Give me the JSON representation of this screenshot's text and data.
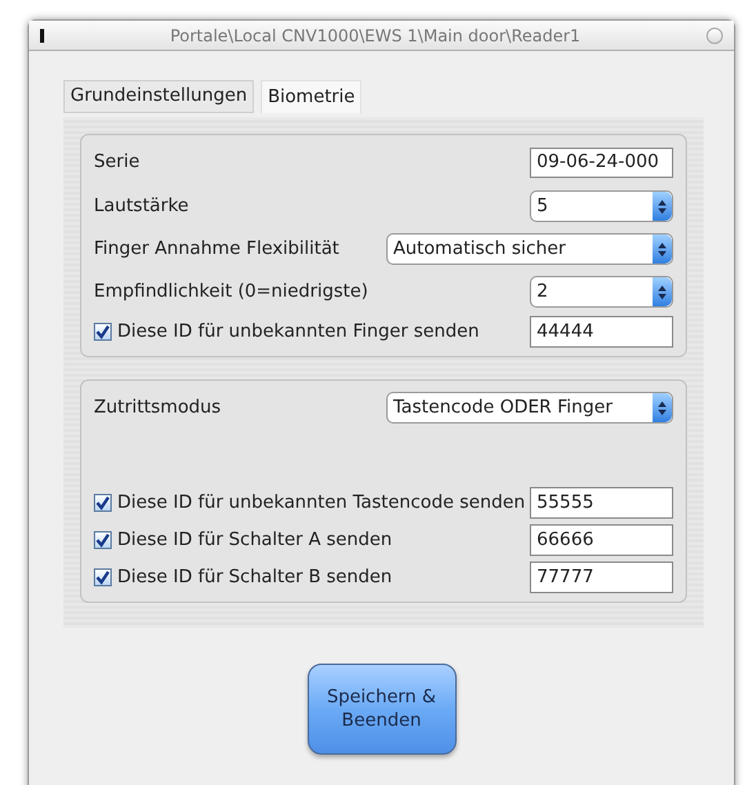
{
  "window": {
    "title": "Portale\\Local CNV1000\\EWS 1\\Main door\\Reader1"
  },
  "tabs": [
    {
      "label": "Grundeinstellungen",
      "selected": false
    },
    {
      "label": "Biometrie",
      "selected": true
    }
  ],
  "groups": [
    {
      "rows": [
        {
          "kind": "field",
          "label": "Serie",
          "value": "09-06-24-000"
        },
        {
          "kind": "select",
          "label": "Lautstärke",
          "value": "5"
        },
        {
          "kind": "wide_select",
          "label": "Finger Annahme Flexibilität",
          "value": "Automatisch sicher"
        },
        {
          "kind": "select",
          "label": "Empfindlichkeit (0=niedrigste)",
          "value": "2"
        },
        {
          "kind": "check_field",
          "label": "Diese ID für unbekannten Finger senden",
          "checked": true,
          "value": "44444"
        }
      ]
    },
    {
      "rows": [
        {
          "kind": "wide_select",
          "label": "Zutrittsmodus",
          "value": "Tastencode ODER Finger"
        },
        {
          "kind": "spacer"
        },
        {
          "kind": "check_field",
          "label": "Diese ID für unbekannten Tastencode senden",
          "checked": true,
          "value": "55555"
        },
        {
          "kind": "check_field",
          "label": "Diese ID für Schalter A senden",
          "checked": true,
          "value": "66666"
        },
        {
          "kind": "check_field",
          "label": "Diese ID für Schalter B senden",
          "checked": true,
          "value": "77777"
        }
      ]
    }
  ],
  "save_button": {
    "label": "Speichern &\nBeenden"
  }
}
